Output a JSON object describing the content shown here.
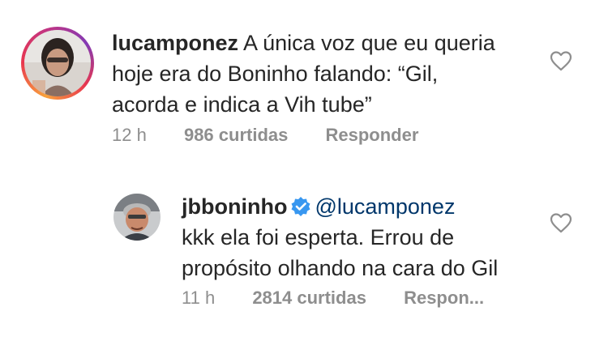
{
  "comments": [
    {
      "username": "lucamponez",
      "text_lines": [
        "A única voz que eu queria",
        "hoje era do Boninho falando: “Gil,",
        "acorda e indica a Vih tube”"
      ],
      "time": "12 h",
      "likes": "986 curtidas",
      "reply_label": "Responder",
      "has_story_ring": true,
      "verified": false
    },
    {
      "username": "jbboninho",
      "mention": "@lucamponez",
      "text_lines": [
        "kkk ela foi esperta. Errou de",
        "propósito olhando na cara do Gil"
      ],
      "time": "11 h",
      "likes": "2814 curtidas",
      "reply_label": "Respon...",
      "has_story_ring": false,
      "verified": true
    }
  ],
  "icons": {
    "like": "heart-outline-icon",
    "verified": "verified-badge-icon"
  },
  "colors": {
    "text": "#262626",
    "meta": "#8e8e8e",
    "mention": "#00376b",
    "verified": "#3897f0"
  }
}
